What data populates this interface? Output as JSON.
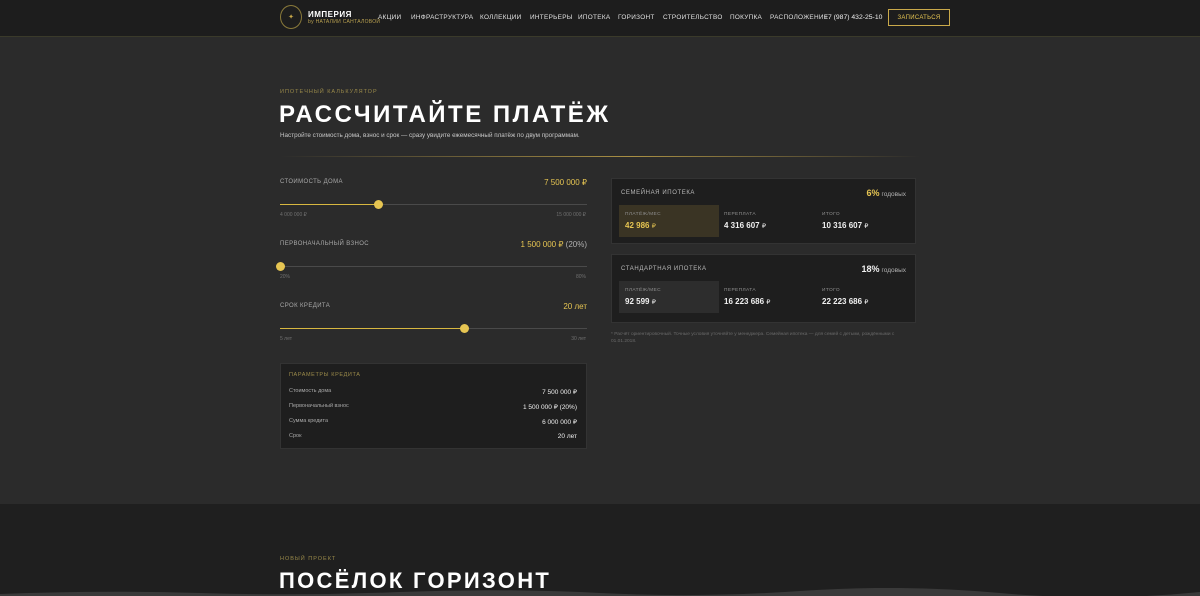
{
  "header": {
    "brand_title": "ИМПЕРИЯ",
    "brand_subtitle": "by НАТАЛИИ САНТАЛОВОЙ",
    "nav": [
      "АКЦИИ",
      "ИНФРАСТРУКТУРА",
      "КОЛЛЕКЦИИ",
      "ИНТЕРЬЕРЫ",
      "ИПОТЕКА",
      "ГОРИЗОНТ",
      "СТРОИТЕЛЬСТВО",
      "ПОКУПКА",
      "РАСПОЛОЖЕНИЕ"
    ],
    "phone": "+7 (987) 432-25-10",
    "cta": "ЗАПИСАТЬСЯ"
  },
  "calculator": {
    "eyebrow": "ИПОТЕЧНЫЙ КАЛЬКУЛЯТОР",
    "title": "РАССЧИТАЙТЕ ПЛАТЁЖ",
    "lead": "Настройте стоимость дома, взнос и срок — сразу увидите ежемесячный платёж по двум программам.",
    "sliders": [
      {
        "label": "СТОИМОСТЬ ДОМА",
        "value": "7 500 000 ₽",
        "value_extra": "",
        "min": "4 000 000 ₽",
        "max": "15 000 000 ₽",
        "fraction": 0.32
      },
      {
        "label": "ПЕРВОНАЧАЛЬНЫЙ ВЗНОС",
        "value": "1 500 000 ₽",
        "value_extra": "(20%)",
        "min": "20%",
        "max": "80%",
        "fraction": 0.0
      },
      {
        "label": "СРОК КРЕДИТА",
        "value": "20 лет",
        "value_extra": "",
        "min": "5 лет",
        "max": "30 лет",
        "fraction": 0.6
      }
    ],
    "params": {
      "title": "ПАРАМЕТРЫ КРЕДИТА",
      "rows": [
        {
          "label": "Стоимость дома",
          "value": "7 500 000 ₽"
        },
        {
          "label": "Первоначальный взнос",
          "value": "1 500 000 ₽ (20%)"
        },
        {
          "label": "Сумма кредита",
          "value": "6 000 000 ₽"
        },
        {
          "label": "Срок",
          "value": "20 лет"
        }
      ]
    },
    "cards": [
      {
        "title": "СЕМЕЙНАЯ ИПОТЕКА",
        "rate": "6%",
        "rate_suffix": "годовых",
        "rate_color": "#e6c552",
        "stats": [
          {
            "label": "ПЛАТЁЖ/МЕС",
            "value": "42 986",
            "unit": "₽"
          },
          {
            "label": "ПЕРЕПЛАТА",
            "value": "4 316 607",
            "unit": "₽"
          },
          {
            "label": "ИТОГО",
            "value": "10 316 607",
            "unit": "₽"
          }
        ]
      },
      {
        "title": "СТАНДАРТНАЯ ИПОТЕКА",
        "rate": "18%",
        "rate_suffix": "годовых",
        "rate_color": "#f0f0f0",
        "stats": [
          {
            "label": "ПЛАТЁЖ/МЕС",
            "value": "92 599",
            "unit": "₽"
          },
          {
            "label": "ПЕРЕПЛАТА",
            "value": "16 223 686",
            "unit": "₽"
          },
          {
            "label": "ИТОГО",
            "value": "22 223 686",
            "unit": "₽"
          }
        ]
      }
    ],
    "note": "* Расчёт ориентировочный. Точные условия уточняйте у менеджера. Семейная ипотека — для семей с детьми, рождёнными с 01.01.2018."
  },
  "project": {
    "eyebrow": "НОВЫЙ ПРОЕКТ",
    "title": "ПОСЁЛОК ГОРИЗОНТ"
  },
  "colors": {
    "accent": "#e6c552",
    "background": "#2b2b2b",
    "panel": "#1e1e1e"
  }
}
